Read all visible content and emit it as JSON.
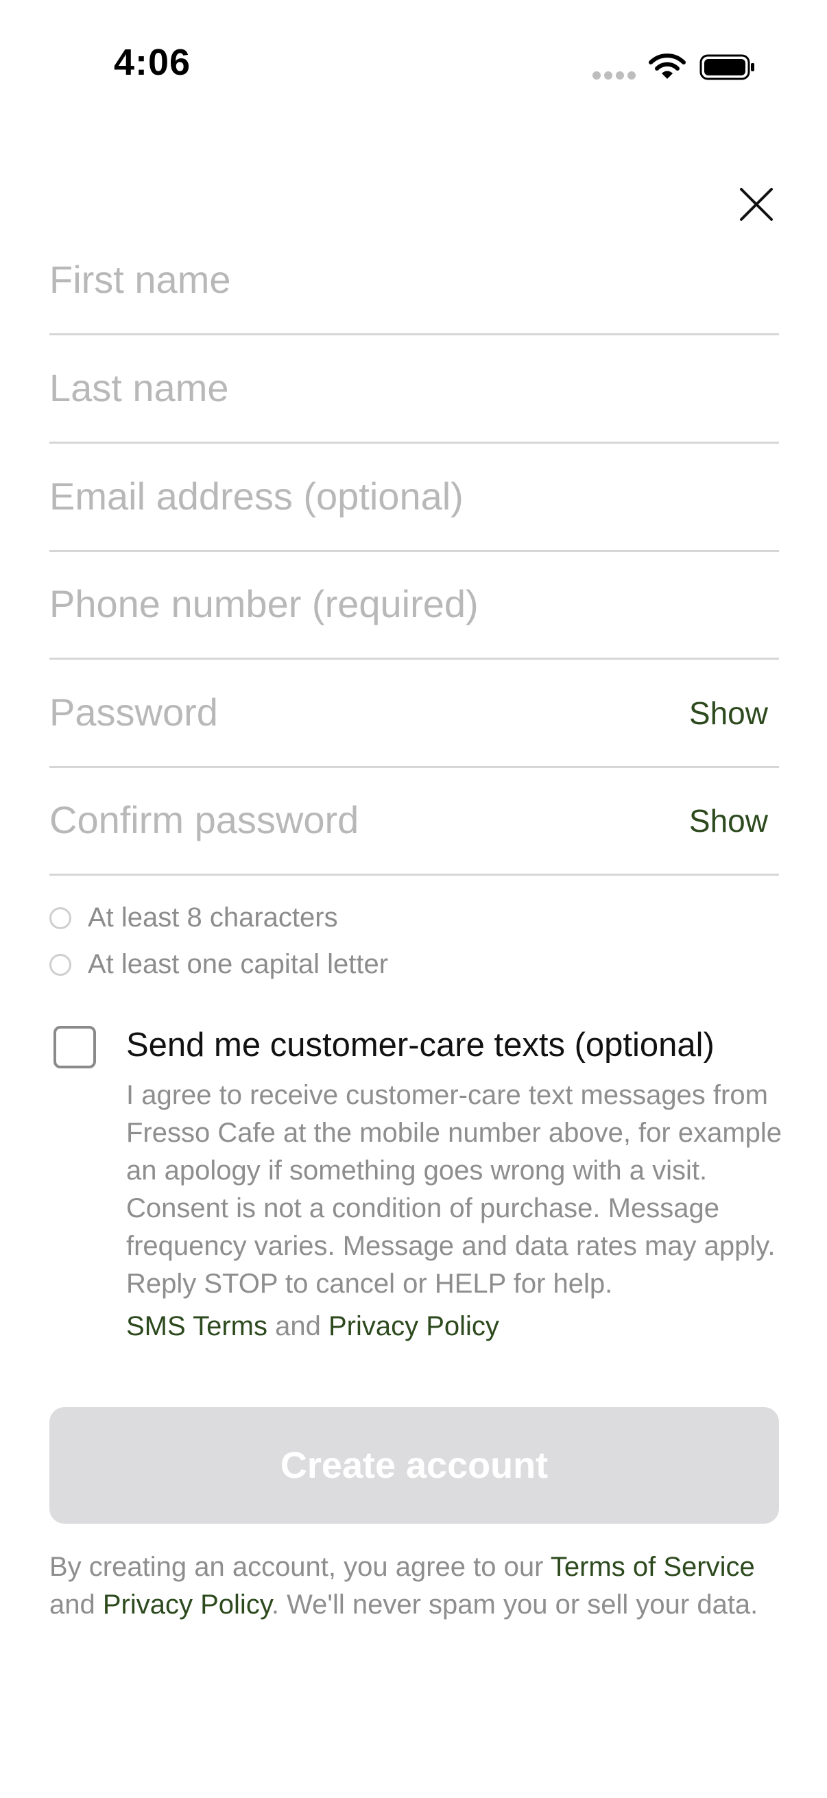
{
  "status_bar": {
    "time": "4:06"
  },
  "form": {
    "first_name": {
      "placeholder": "First name"
    },
    "last_name": {
      "placeholder": "Last name"
    },
    "email": {
      "placeholder": "Email address (optional)"
    },
    "phone": {
      "placeholder": "Phone number (required)"
    },
    "password": {
      "placeholder": "Password",
      "toggle_label": "Show"
    },
    "confirm_password": {
      "placeholder": "Confirm password",
      "toggle_label": "Show"
    }
  },
  "password_rules": [
    {
      "text": "At least 8 characters",
      "met": false
    },
    {
      "text": "At least one capital letter",
      "met": false
    }
  ],
  "sms_consent": {
    "checked": false,
    "title": "Send me customer-care texts (optional)",
    "body": "I agree to receive customer-care text messages from Fresso Cafe at the mobile number above, for example an apology if something goes wrong with a visit. Consent is not a condition of purchase. Message frequency varies. Message and data rates may apply. Reply STOP to cancel or HELP for help.",
    "sms_terms_link": "SMS Terms",
    "conjunction": "and",
    "privacy_link": "Privacy Policy"
  },
  "create_button": {
    "label": "Create account",
    "enabled": false
  },
  "footer": {
    "prefix": "By creating an account, you agree to our",
    "terms_link": "Terms of Service",
    "conjunction": "and",
    "privacy_link": "Privacy Policy",
    "suffix": ". We'll never spam you or sell your data."
  },
  "colors": {
    "link": "#2d4a1e",
    "placeholder": "#b8b8b8",
    "muted_text": "#8e8e8e",
    "disabled_button": "#dcdcde"
  },
  "icons": [
    "wifi-icon",
    "battery-icon",
    "cellular-signal-icon",
    "close-icon",
    "radio-icon",
    "checkbox-icon"
  ]
}
